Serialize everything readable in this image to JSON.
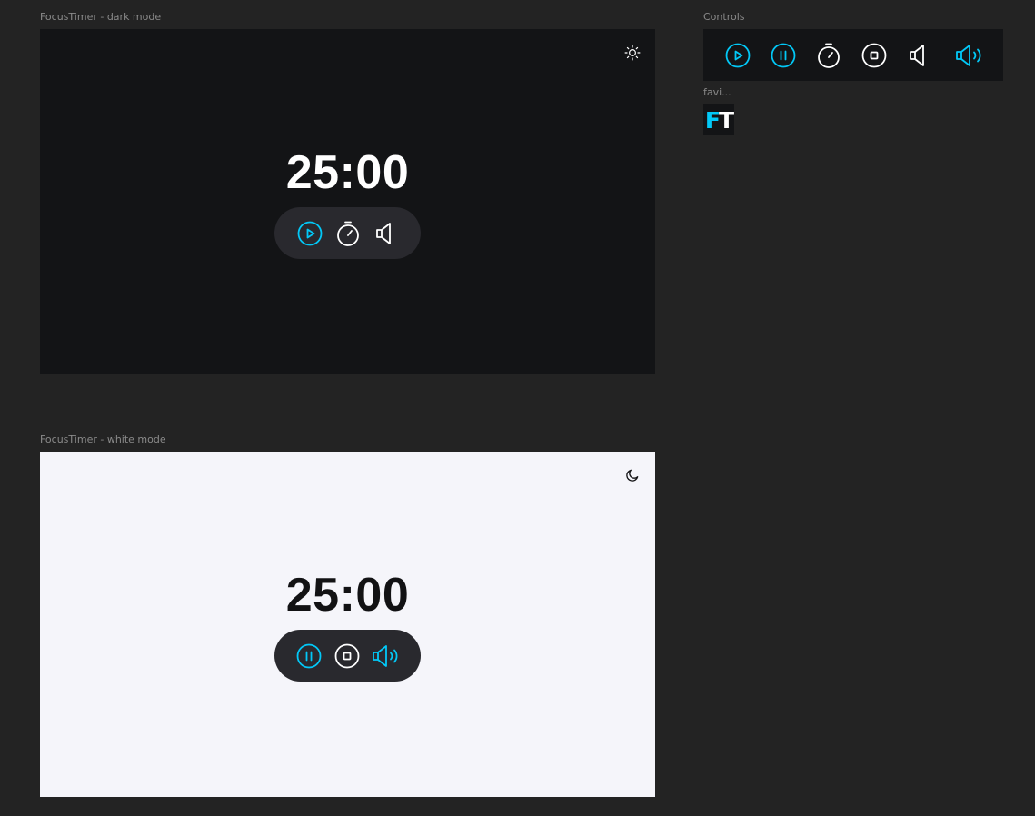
{
  "frames": {
    "dark": {
      "label": "FocusTimer - dark mode",
      "timer": "25:00",
      "theme_toggle_icon": "sun-icon"
    },
    "light": {
      "label": "FocusTimer - white mode",
      "timer": "25:00",
      "theme_toggle_icon": "moon-icon"
    }
  },
  "controls": {
    "label": "Controls",
    "icons": [
      "play-icon",
      "pause-icon",
      "stopwatch-icon",
      "stop-icon",
      "sound-off-icon",
      "sound-on-icon"
    ]
  },
  "favicon": {
    "label": "favi...",
    "letter_f": "F",
    "letter_t": "T"
  },
  "colors": {
    "accent": "#02c8f7",
    "canvas": "#232323",
    "dark_bg": "#131416",
    "light_bg": "#f5f5fa",
    "pill_bg": "#29292e",
    "white": "#ffffff"
  }
}
